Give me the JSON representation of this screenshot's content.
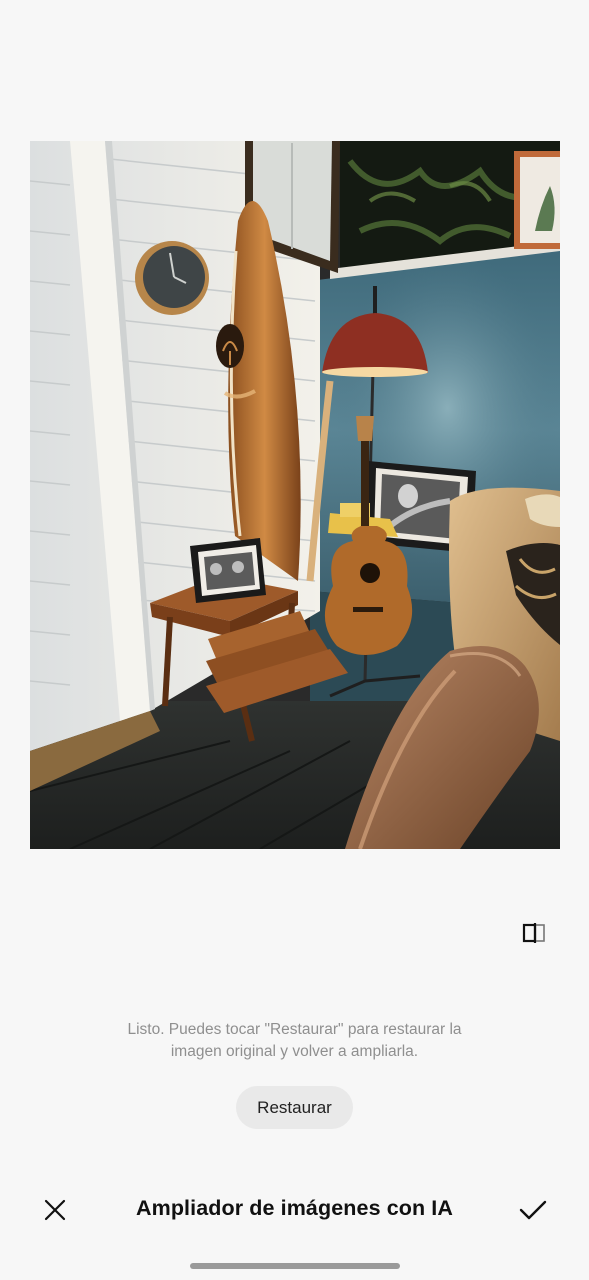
{
  "image": {
    "description_icon": "enlarged-photo"
  },
  "compare": {
    "icon": "compare-icon"
  },
  "message": {
    "line1": "Listo. Puedes tocar \"Restaurar\" para restaurar la",
    "line2": "imagen original y volver a ampliarla."
  },
  "restore_button": {
    "label": "Restaurar"
  },
  "bottom_bar": {
    "title": "Ampliador de imágenes con IA",
    "close_icon": "close-icon",
    "confirm_icon": "check-icon"
  },
  "colors": {
    "background": "#f7f7f7",
    "button_bg": "#e9e9e9",
    "message_text": "#8f8f8f",
    "title_text": "#111111"
  }
}
